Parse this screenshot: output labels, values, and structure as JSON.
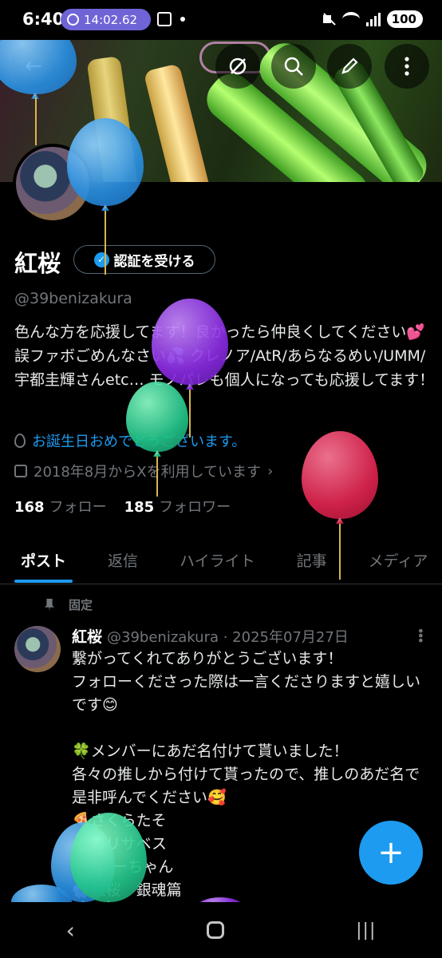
{
  "status_bar": {
    "time": "6:40",
    "timer": "14:02.62",
    "battery": "100"
  },
  "header": {
    "back_icon": "arrow-left-icon",
    "grok_icon": "grok-icon",
    "search_icon": "search-icon",
    "edit_icon": "pencil-icon",
    "more_icon": "more-vertical-icon"
  },
  "profile": {
    "name": "紅桜",
    "verify_label": "認証を受ける",
    "handle": "@39benizakura",
    "bio": "色んな方を応援してます！良かったら仲良くしてください💕誤ファボごめんなさい💦 クレノア/AtR/あらなるめい/UMM/宇都圭輝さんetc… モノパレも個人になっても応援してます！",
    "birthday": "お誕生日おめでとうございます。",
    "joined": "2018年8月からXを利用しています",
    "following_count": "168",
    "following_label": "フォロー",
    "followers_count": "185",
    "followers_label": "フォロワー"
  },
  "tabs": [
    {
      "label": "ポスト"
    },
    {
      "label": "返信"
    },
    {
      "label": "ハイライト"
    },
    {
      "label": "記事"
    },
    {
      "label": "メディア"
    }
  ],
  "post": {
    "pinned_label": "固定",
    "author": "紅桜",
    "handle_date": "@39benizakura · 2025年07月27日",
    "body": "繋がってくれてありがとうございます！\nフォローくださった際は一言くださりますと嬉しいです😊\n\n🍀メンバーにあだ名付けて貰いました！\n各々の推しから付けて貰ったので、推しのあだ名で是非呼んでください🥰\n🍕さくらたそ\n🌈ロリサベス\n⚡べにーちゃん\n🌸紅桜　銀魂篇"
  },
  "fab": {
    "label": "+"
  },
  "nav": {
    "back": "‹",
    "recents": "|||"
  },
  "colors": {
    "accent": "#1d9bf0",
    "background": "#000000",
    "muted": "#71767b"
  }
}
